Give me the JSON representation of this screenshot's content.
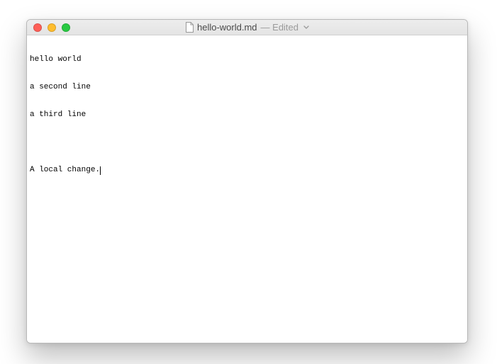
{
  "titlebar": {
    "filename": "hello-world.md",
    "status": "— Edited",
    "icons": {
      "file": "file-icon",
      "chevron": "chevron-down-icon"
    }
  },
  "editor": {
    "lines": [
      "hello world",
      "a second line",
      "a third line",
      "",
      "A local change."
    ]
  }
}
